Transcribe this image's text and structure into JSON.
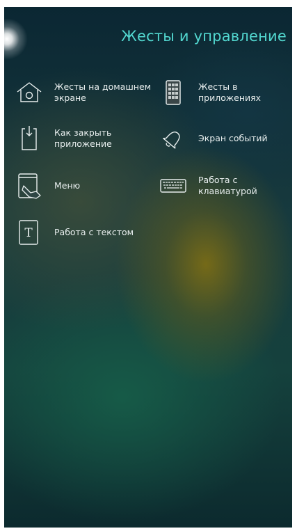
{
  "header": {
    "title": "Жесты и управление"
  },
  "items": [
    {
      "label": "Жесты на домашнем экране",
      "icon": "home-icon"
    },
    {
      "label": "Жесты в приложениях",
      "icon": "app-grid-icon"
    },
    {
      "label": "Как закрыть приложение",
      "icon": "close-app-icon"
    },
    {
      "label": "Экран событий",
      "icon": "bell-icon"
    },
    {
      "label": "Меню",
      "icon": "menu-gesture-icon"
    },
    {
      "label": "Работа с клавиатурой",
      "icon": "keyboard-icon"
    },
    {
      "label": "Работа с текстом",
      "icon": "text-icon"
    }
  ]
}
